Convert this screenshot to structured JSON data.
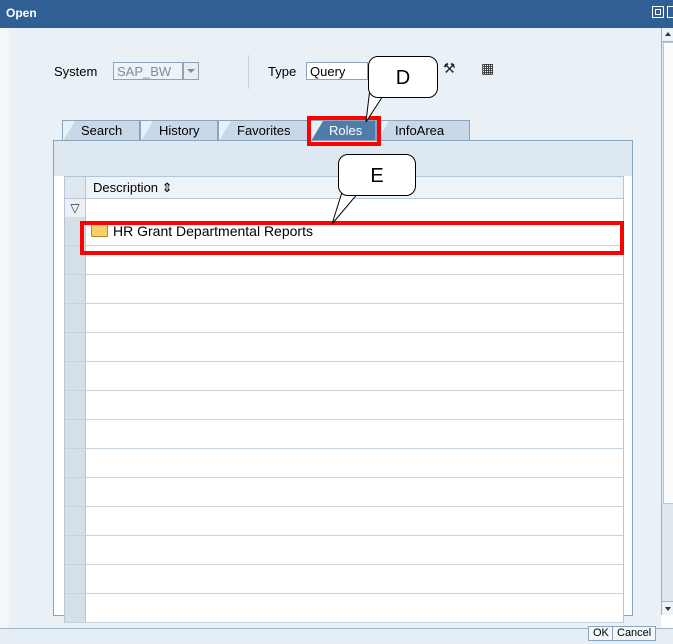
{
  "window": {
    "title": "Open"
  },
  "toolbar": {
    "system_label": "System",
    "system_value": "SAP_BW",
    "type_label": "Type",
    "type_value": "Query",
    "icons": [
      "tool-icon",
      "list-view-icon"
    ]
  },
  "tabs": [
    {
      "label": "Search",
      "active": false
    },
    {
      "label": "History",
      "active": false
    },
    {
      "label": "Favorites",
      "active": false
    },
    {
      "label": "Roles",
      "active": true
    },
    {
      "label": "InfoArea",
      "active": false
    }
  ],
  "table": {
    "column_header": "Description",
    "sort_icon": "sort-icon",
    "filter_icon": "filter-icon",
    "rows": [
      {
        "label": "HR Grant Departmental Reports",
        "icon": "folder-icon"
      }
    ]
  },
  "callouts": {
    "d": "D",
    "e": "E"
  },
  "buttons": {
    "ok": "OK",
    "cancel": "Cancel"
  },
  "colors": {
    "titlebar": "#2f5f93",
    "highlight": "#ff0000",
    "active_tab": "#4f7ca8"
  }
}
